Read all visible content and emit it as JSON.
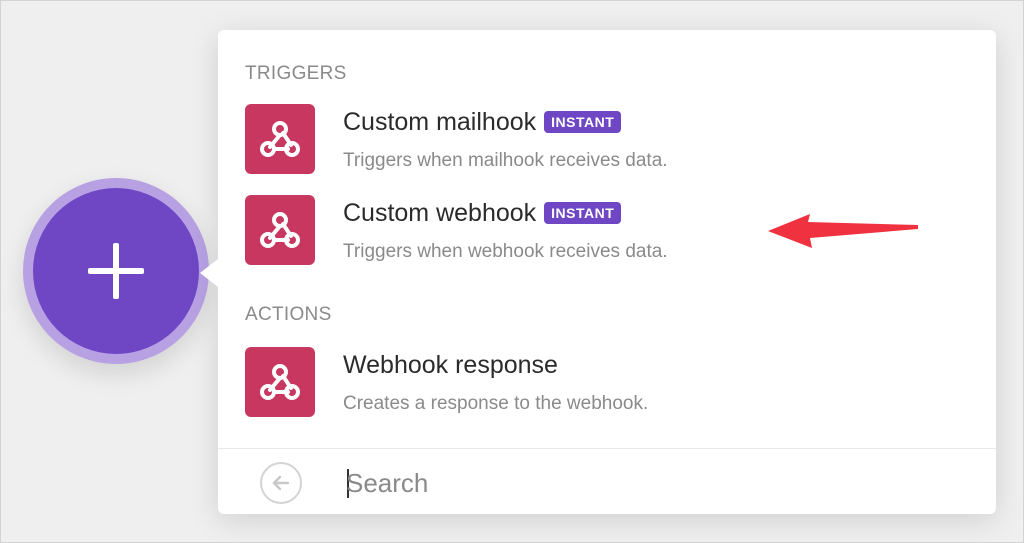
{
  "triggers": {
    "section_label": "TRIGGERS",
    "items": [
      {
        "title": "Custom mailhook",
        "badge": "INSTANT",
        "description": "Triggers when mailhook receives data.",
        "icon": "webhook-icon"
      },
      {
        "title": "Custom webhook",
        "badge": "INSTANT",
        "description": "Triggers when webhook receives data.",
        "icon": "webhook-icon"
      }
    ]
  },
  "actions": {
    "section_label": "ACTIONS",
    "items": [
      {
        "title": "Webhook response",
        "description": "Creates a response to the webhook.",
        "icon": "webhook-icon"
      }
    ]
  },
  "search": {
    "placeholder": "Search",
    "value": ""
  },
  "icons": {
    "add": "plus-icon",
    "back": "arrow-left-icon",
    "annotation": "red-arrow-icon"
  },
  "colors": {
    "accent": "#6f47c5",
    "app_icon_bg": "#c8375f",
    "annotation_arrow": "#f0313f"
  }
}
